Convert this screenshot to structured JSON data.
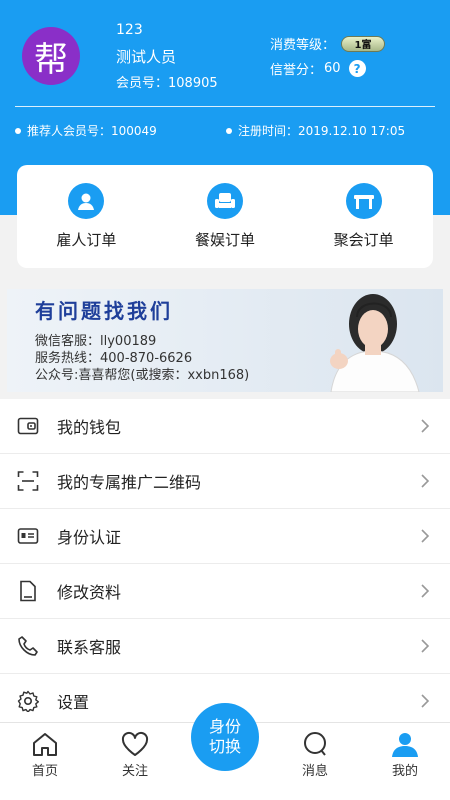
{
  "profile": {
    "avatar_char": "帮",
    "name": "123",
    "title": "测试人员",
    "member_id": "会员号：108905",
    "level_label": "消费等级：",
    "level_badge": "1富",
    "credit_label": "信誉分：",
    "credit_value": "60",
    "help_symbol": "?",
    "referrer": "推荐人会员号：100049",
    "register_time": "注册时间：2019.12.10 17:05"
  },
  "orders": [
    {
      "label": "雇人订单",
      "icon": "person-icon"
    },
    {
      "label": "餐娱订单",
      "icon": "armchair-icon"
    },
    {
      "label": "聚会订单",
      "icon": "table-icon"
    }
  ],
  "banner": {
    "title": "有问题找我们",
    "wechat": "微信客服：lly00189",
    "hotline": "服务热线：400-870-6626",
    "account": "公众号:喜喜帮您(或搜索：xxbn168)"
  },
  "menu": [
    {
      "label": "我的钱包",
      "icon": "wallet-icon"
    },
    {
      "label": "我的专属推广二维码",
      "icon": "scan-icon"
    },
    {
      "label": "身份认证",
      "icon": "id-card-icon"
    },
    {
      "label": "修改资料",
      "icon": "document-icon"
    },
    {
      "label": "联系客服",
      "icon": "phone-icon"
    },
    {
      "label": "设置",
      "icon": "gear-icon"
    }
  ],
  "tabbar": {
    "home": "首页",
    "follow": "关注",
    "switch_line1": "身份",
    "switch_line2": "切换",
    "messages": "消息",
    "mine": "我的"
  },
  "colors": {
    "primary": "#1a9df2",
    "avatar": "#8a2fc8"
  }
}
